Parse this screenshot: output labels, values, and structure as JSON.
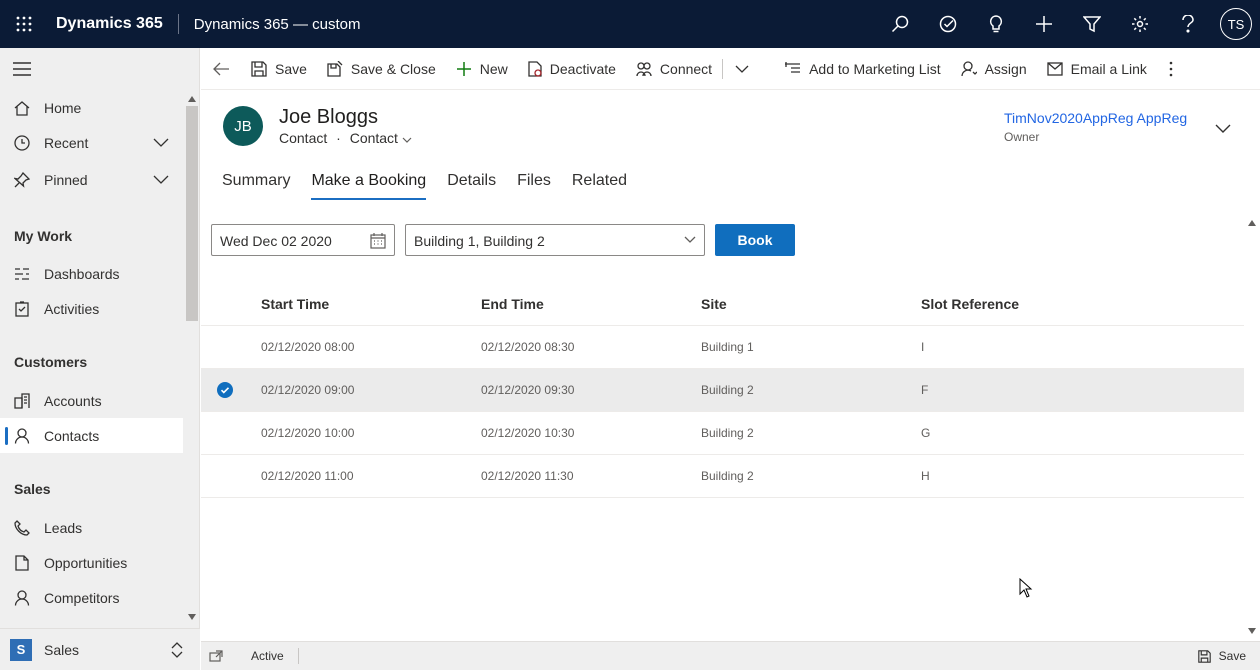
{
  "topbar": {
    "brand": "Dynamics 365",
    "app_name": "Dynamics 365 — custom",
    "user_initials": "TS",
    "icons": [
      "search-icon",
      "task-icon",
      "lightbulb-icon",
      "plus-icon",
      "filter-icon",
      "gear-icon",
      "help-icon"
    ]
  },
  "sidebar": {
    "items": [
      {
        "label": "Home",
        "icon": "home-icon"
      },
      {
        "label": "Recent",
        "icon": "clock-icon"
      },
      {
        "label": "Pinned",
        "icon": "pin-icon"
      }
    ],
    "groups": [
      {
        "title": "My Work",
        "items": [
          {
            "label": "Dashboards"
          },
          {
            "label": "Activities"
          }
        ]
      },
      {
        "title": "Customers",
        "items": [
          {
            "label": "Accounts"
          },
          {
            "label": "Contacts"
          }
        ]
      },
      {
        "title": "Sales",
        "items": [
          {
            "label": "Leads"
          },
          {
            "label": "Opportunities"
          },
          {
            "label": "Competitors"
          }
        ]
      }
    ],
    "selected": "Contacts",
    "area": {
      "badge": "S",
      "label": "Sales"
    }
  },
  "commandbar": {
    "save": "Save",
    "save_close": "Save & Close",
    "new": "New",
    "deactivate": "Deactivate",
    "connect": "Connect",
    "add_marketing": "Add to Marketing List",
    "assign": "Assign",
    "email_link": "Email a Link"
  },
  "record": {
    "initials": "JB",
    "name": "Joe Bloggs",
    "entity": "Contact",
    "form": "Contact",
    "owner": "TimNov2020AppReg AppReg",
    "owner_label": "Owner"
  },
  "tabs": [
    "Summary",
    "Make a Booking",
    "Details",
    "Files",
    "Related"
  ],
  "active_tab": "Make a Booking",
  "booking": {
    "date": "Wed Dec 02 2020",
    "sites": "Building 1, Building 2",
    "book_label": "Book"
  },
  "grid": {
    "columns": [
      "Start Time",
      "End Time",
      "Site",
      "Slot Reference"
    ],
    "rows": [
      {
        "start": "02/12/2020 08:00",
        "end": "02/12/2020 08:30",
        "site": "Building 1",
        "ref": "I",
        "selected": false
      },
      {
        "start": "02/12/2020 09:00",
        "end": "02/12/2020 09:30",
        "site": "Building 2",
        "ref": "F",
        "selected": true
      },
      {
        "start": "02/12/2020 10:00",
        "end": "02/12/2020 10:30",
        "site": "Building 2",
        "ref": "G",
        "selected": false
      },
      {
        "start": "02/12/2020 11:00",
        "end": "02/12/2020 11:30",
        "site": "Building 2",
        "ref": "H",
        "selected": false
      }
    ]
  },
  "footer": {
    "status": "Active",
    "save": "Save"
  }
}
